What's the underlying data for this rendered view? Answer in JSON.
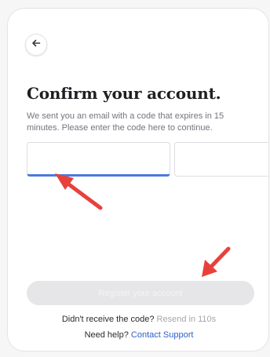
{
  "header": {
    "back_icon": "arrow-left-icon"
  },
  "title": "Confirm your account.",
  "subtitle": "We sent you an email with a code that expires in 15 minutes. Please enter the code here to continue.",
  "code_inputs": {
    "count": 6,
    "values": [
      "",
      "",
      "",
      "",
      "",
      ""
    ],
    "active_index": 0
  },
  "register_button": {
    "label": "Register your account",
    "disabled": true
  },
  "resend": {
    "prompt": "Didn't receive the code?",
    "link": "Resend in 110s"
  },
  "help": {
    "prompt": "Need help?",
    "link": "Contact Support"
  },
  "colors": {
    "accent": "#4a7ae0",
    "link": "#2f60c9",
    "annotation_arrow": "#e8413c",
    "button_disabled_bg": "#e6e6e8"
  }
}
